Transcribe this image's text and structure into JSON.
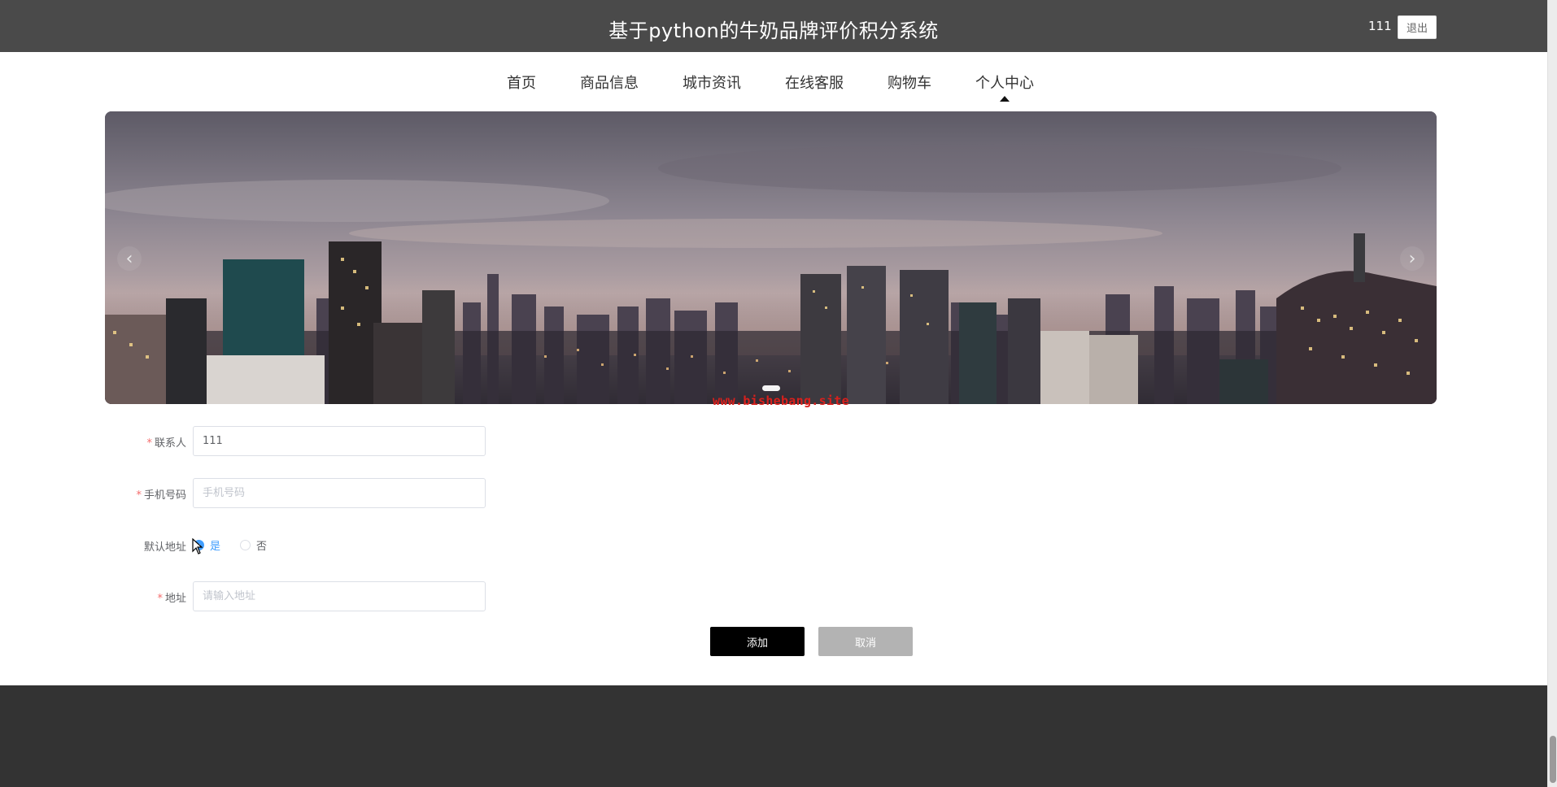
{
  "header": {
    "title": "基于python的牛奶品牌评价积分系统",
    "username": "111",
    "logout_label": "退出"
  },
  "nav": {
    "items": [
      {
        "label": "首页"
      },
      {
        "label": "商品信息"
      },
      {
        "label": "城市资讯"
      },
      {
        "label": "在线客服"
      },
      {
        "label": "购物车"
      },
      {
        "label": "个人中心"
      }
    ],
    "active": "个人中心"
  },
  "banner": {
    "prev_icon": "‹",
    "next_icon": "›",
    "watermark": "www.bishebang.site",
    "slide_count": 1
  },
  "form": {
    "contact": {
      "label": "联系人",
      "value": "111",
      "required": true
    },
    "phone": {
      "label": "手机号码",
      "placeholder": "手机号码",
      "required": true
    },
    "default_address": {
      "label": "默认地址",
      "options": [
        "是",
        "否"
      ],
      "selected": "是"
    },
    "address": {
      "label": "地址",
      "placeholder": "请输入地址",
      "required": true
    }
  },
  "actions": {
    "add_label": "添加",
    "cancel_label": "取消"
  },
  "colors": {
    "header_bg": "#4a4a4a",
    "footer_bg": "#333333",
    "primary_button": "#000000",
    "cancel_button": "#b3b3b3",
    "required_mark": "#f56c6c",
    "radio_active": "#409eff"
  }
}
